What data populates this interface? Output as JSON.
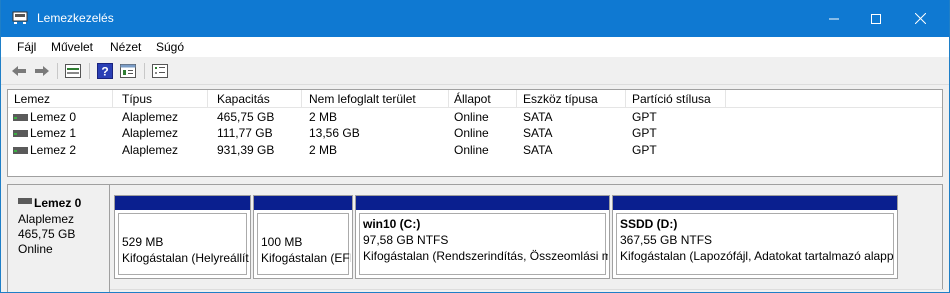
{
  "window": {
    "title": "Lemezkezelés"
  },
  "menu": [
    "Fájl",
    "Művelet",
    "Nézet",
    "Súgó"
  ],
  "toolbar": [
    "back-icon",
    "forward-icon",
    "disk-list-icon",
    "help-icon",
    "properties-icon",
    "settings-icon"
  ],
  "list": {
    "columns": [
      "Lemez",
      "Típus",
      "Kapacitás",
      "Nem lefoglalt terület",
      "Állapot",
      "Eszköz típusa",
      "Partíció stílusa"
    ],
    "rows": [
      [
        "Lemez 0",
        "Alaplemez",
        "465,75 GB",
        "2 MB",
        "Online",
        "SATA",
        "GPT"
      ],
      [
        "Lemez 1",
        "Alaplemez",
        "111,77 GB",
        "13,56 GB",
        "Online",
        "SATA",
        "GPT"
      ],
      [
        "Lemez 2",
        "Alaplemez",
        "931,39 GB",
        "2 MB",
        "Online",
        "SATA",
        "GPT"
      ]
    ]
  },
  "graph": {
    "disk": {
      "name": "Lemez 0",
      "type": "Alaplemez",
      "size": "465,75 GB",
      "status": "Online"
    },
    "partitions": [
      {
        "name": "",
        "size": "529 MB",
        "status": "Kifogástalan (Helyreállít"
      },
      {
        "name": "",
        "size": "100 MB",
        "status": "Kifogástalan (EFI"
      },
      {
        "name": "win10  (C:)",
        "size": "97,58 GB NTFS",
        "status": "Kifogástalan (Rendszerindítás, Összeomlási m"
      },
      {
        "name": "SSDD  (D:)",
        "size": "367,55 GB NTFS",
        "status": "Kifogástalan (Lapozófájl, Adatokat tartalmazó alapp"
      }
    ]
  },
  "colors": {
    "titlebar": "#0f79d2",
    "partition_bar": "#0a1f8f"
  }
}
